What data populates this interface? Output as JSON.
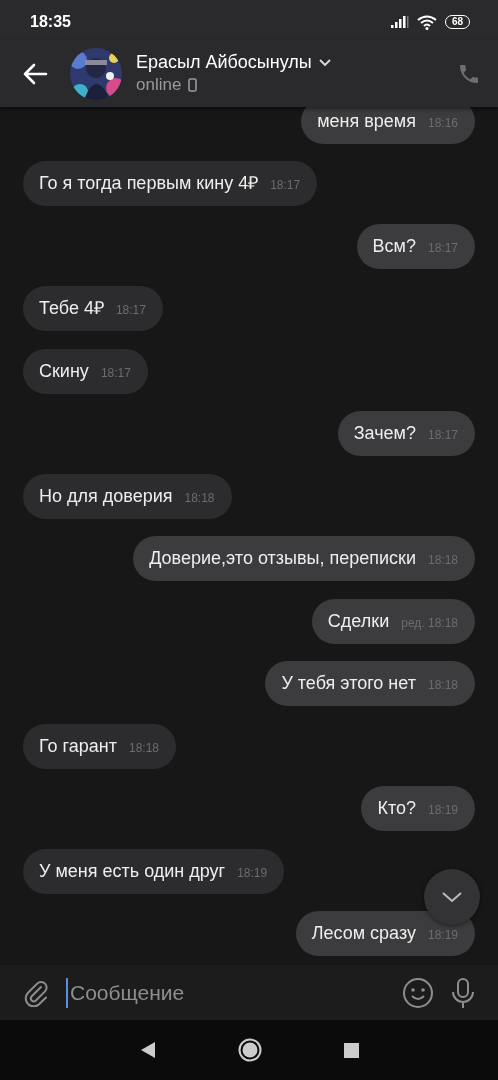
{
  "status_bar": {
    "time": "18:35",
    "battery": "68"
  },
  "header": {
    "name": "Ерасыл Айбосынулы",
    "status": "online"
  },
  "messages": [
    {
      "kind": "outgoing",
      "text": "меня время",
      "time": "18:16"
    },
    {
      "kind": "incoming",
      "text": "Го я тогда первым кину 4₽",
      "time": "18:17"
    },
    {
      "kind": "outgoing",
      "text": "Всм?",
      "time": "18:17"
    },
    {
      "kind": "incoming",
      "text": "Тебе 4₽",
      "time": "18:17"
    },
    {
      "kind": "incoming",
      "text": "Скину",
      "time": "18:17"
    },
    {
      "kind": "outgoing",
      "text": "Зачем?",
      "time": "18:17"
    },
    {
      "kind": "incoming",
      "text": "Но для доверия",
      "time": "18:18"
    },
    {
      "kind": "outgoing",
      "text": "Доверие,это отзывы, переписки",
      "time": "18:18"
    },
    {
      "kind": "outgoing",
      "text": "Сделки",
      "time": "ред. 18:18"
    },
    {
      "kind": "outgoing",
      "text": "У тебя этого нет",
      "time": "18:18"
    },
    {
      "kind": "incoming",
      "text": "Го гарант",
      "time": "18:18"
    },
    {
      "kind": "outgoing",
      "text": "Кто?",
      "time": "18:19"
    },
    {
      "kind": "incoming",
      "text": "У меня есть один друг",
      "time": "18:19"
    },
    {
      "kind": "outgoing",
      "text": "Лесом сразу",
      "time": "18:19"
    }
  ],
  "composer": {
    "placeholder": "Сообщение"
  }
}
